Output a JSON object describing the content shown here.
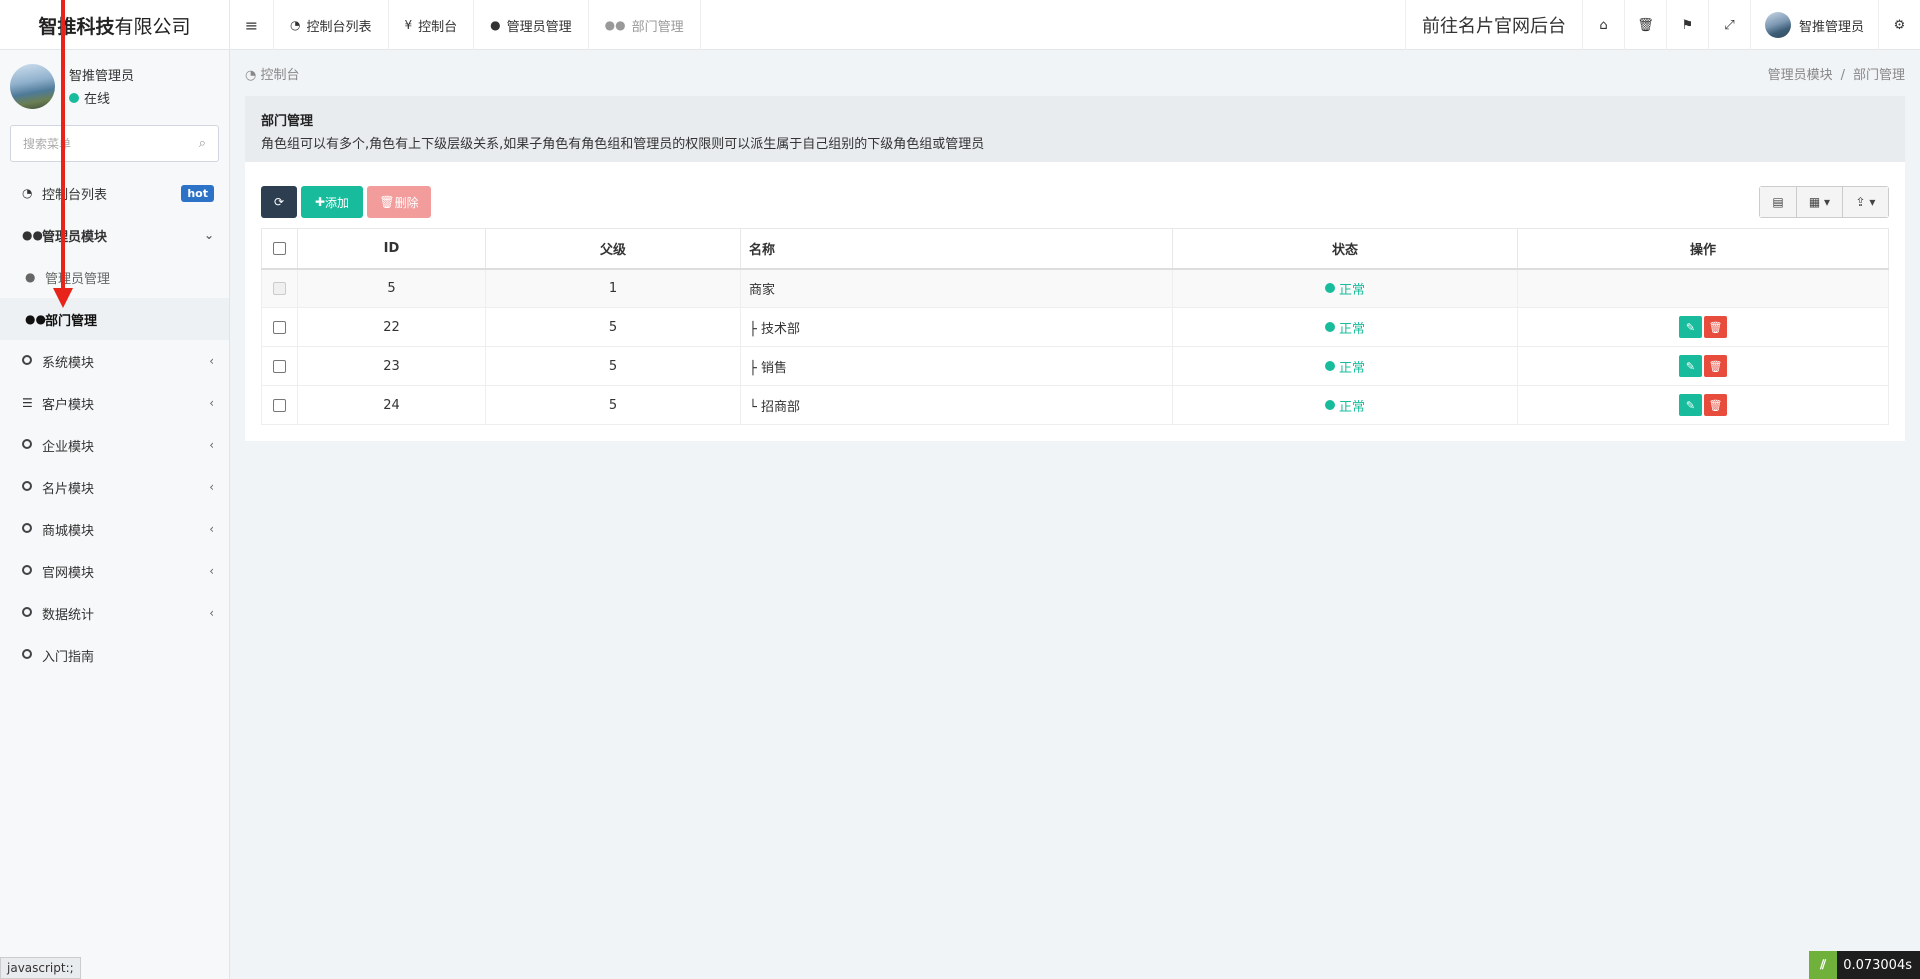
{
  "header": {
    "logo_bold": "智推科技",
    "logo_rest": "有限公司",
    "tabs": [
      {
        "label": "控制台列表",
        "icon": "dashboard-icon"
      },
      {
        "label": "控制台",
        "icon": "yen-icon"
      },
      {
        "label": "管理员管理",
        "icon": "user-icon"
      },
      {
        "label": "部门管理",
        "icon": "users-icon"
      }
    ],
    "active_tab_index": 3,
    "site_link": "前往名片官网后台",
    "username": "智推管理员"
  },
  "sidebar": {
    "user_name": "智推管理员",
    "user_status": "在线",
    "search_placeholder": "搜索菜单",
    "items": [
      {
        "label": "控制台列表",
        "badge": "hot"
      },
      {
        "label": "管理员模块"
      },
      {
        "label": "管理员管理"
      },
      {
        "label": "部门管理"
      },
      {
        "label": "系统模块"
      },
      {
        "label": "客户模块"
      },
      {
        "label": "企业模块"
      },
      {
        "label": "名片模块"
      },
      {
        "label": "商城模块"
      },
      {
        "label": "官网模块"
      },
      {
        "label": "数据统计"
      },
      {
        "label": "入门指南"
      }
    ]
  },
  "breadcrumb": {
    "home": "控制台",
    "path": [
      "管理员模块",
      "部门管理"
    ]
  },
  "panel": {
    "title": "部门管理",
    "description": "角色组可以有多个,角色有上下级层级关系,如果子角色有角色组和管理员的权限则可以派生属于自己组别的下级角色组或管理员"
  },
  "toolbar": {
    "add_label": "添加",
    "delete_label": "删除"
  },
  "table": {
    "columns": [
      "ID",
      "父级",
      "名称",
      "状态",
      "操作"
    ],
    "rows": [
      {
        "id": "5",
        "parent": "1",
        "name": "商家",
        "status": "正常",
        "actions": false
      },
      {
        "id": "22",
        "parent": "5",
        "name": "├ 技术部",
        "status": "正常",
        "actions": true
      },
      {
        "id": "23",
        "parent": "5",
        "name": "├ 销售",
        "status": "正常",
        "actions": true
      },
      {
        "id": "24",
        "parent": "5",
        "name": "└ 招商部",
        "status": "正常",
        "actions": true
      }
    ]
  },
  "statusbar_text": "javascript:;",
  "timer_text": "0.073004s",
  "colors": {
    "accent_green": "#18bc9c",
    "danger_red": "#e74c3c",
    "dark": "#2c3e50",
    "hot_badge": "#2c72c7",
    "annotation_red": "#e8231a"
  }
}
